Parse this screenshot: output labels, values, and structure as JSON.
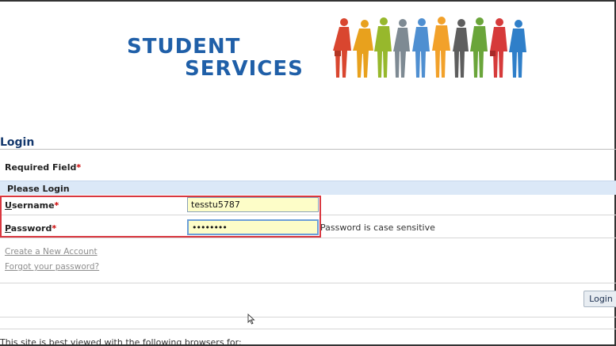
{
  "brand": {
    "line1": "STUDENT",
    "line2": "SERVICES",
    "color": "#1f5fa8"
  },
  "page": {
    "title": "Login"
  },
  "form": {
    "required_label": "Required Field",
    "required_marker": "*",
    "section_title": "Please Login",
    "username": {
      "label_first": "U",
      "label_rest": "sername",
      "marker": "*",
      "value": "tesstu5787"
    },
    "password": {
      "label_first": "P",
      "label_rest": "assword",
      "marker": "*",
      "value": "••••••••",
      "hint": "Password is case sensitive"
    },
    "links": {
      "create_account": "Create a New Account",
      "forgot_password": "Forgot your password?"
    },
    "submit_label": "Login"
  },
  "footer": {
    "text": "This site is best viewed with the following browsers for:"
  },
  "colors": {
    "title": "#14386d",
    "section_bar": "#dbe8f7",
    "highlight": "#d9373f",
    "input_bg": "#fdfdc8",
    "required": "#cc0000"
  }
}
